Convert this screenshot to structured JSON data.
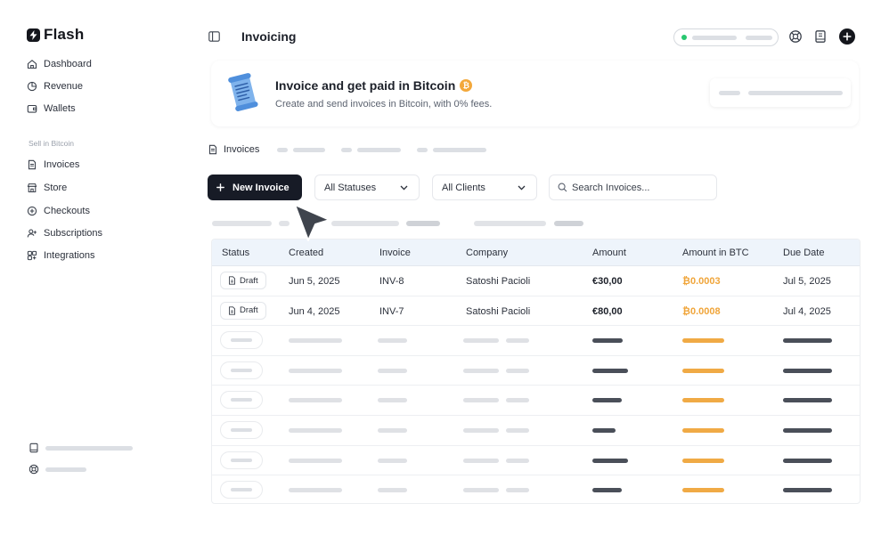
{
  "app": {
    "name": "Flash"
  },
  "sidebar": {
    "items": [
      {
        "label": "Dashboard",
        "icon": "home-icon"
      },
      {
        "label": "Revenue",
        "icon": "chart-icon"
      },
      {
        "label": "Wallets",
        "icon": "wallet-icon"
      }
    ],
    "section_title": "Sell in Bitcoin",
    "sell_items": [
      {
        "label": "Invoices",
        "icon": "invoice-icon"
      },
      {
        "label": "Store",
        "icon": "store-icon"
      },
      {
        "label": "Checkouts",
        "icon": "checkout-icon"
      },
      {
        "label": "Subscriptions",
        "icon": "subscriptions-icon"
      },
      {
        "label": "Integrations",
        "icon": "integrations-icon"
      }
    ]
  },
  "header": {
    "title": "Invoicing"
  },
  "banner": {
    "title": "Invoice and get paid in Bitcoin",
    "subtitle": "Create and send invoices in Bitcoin, with 0% fees.",
    "coin_symbol": "₿"
  },
  "tabs": {
    "active_label": "Invoices"
  },
  "toolbar": {
    "new_invoice_label": "New Invoice",
    "status_filter": "All Statuses",
    "client_filter": "All Clients",
    "search_placeholder": "Search Invoices..."
  },
  "table": {
    "columns": [
      "Status",
      "Created",
      "Invoice",
      "Company",
      "Amount",
      "Amount in BTC",
      "Due Date"
    ],
    "rows": [
      {
        "status": "Draft",
        "created": "Jun 5, 2025",
        "invoice": "INV-8",
        "company": "Satoshi Pacioli",
        "amount": "€30,00",
        "amount_btc": "₿0.0003",
        "due": "Jul 5, 2025"
      },
      {
        "status": "Draft",
        "created": "Jun 4, 2025",
        "invoice": "INV-7",
        "company": "Satoshi Pacioli",
        "amount": "€80,00",
        "amount_btc": "₿0.0008",
        "due": "Jul 4, 2025"
      }
    ],
    "placeholder_row_count": 6
  },
  "colors": {
    "accent_dark": "#171b26",
    "btc_orange": "#f0a53a",
    "status_green": "#28c76f",
    "table_header_bg": "#eef4fb"
  }
}
